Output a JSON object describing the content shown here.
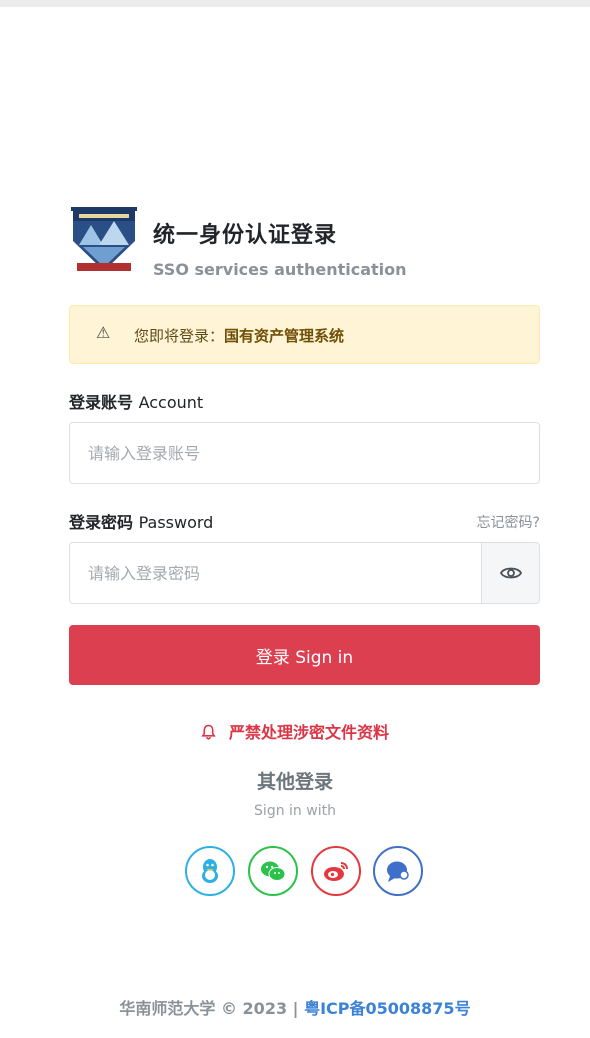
{
  "header": {
    "title": "统一身份认证登录",
    "subtitle": "SSO services authentication"
  },
  "alert": {
    "prefix": "您即将登录：",
    "system_name": "国有资产管理系统",
    "icon": "warning-triangle-icon"
  },
  "account": {
    "label_cn": "登录账号",
    "label_en": "Account",
    "placeholder": "请输入登录账号"
  },
  "password": {
    "label_cn": "登录密码",
    "label_en": "Password",
    "placeholder": "请输入登录密码",
    "forgot_link": "忘记密码?",
    "toggle_icon": "eye-icon"
  },
  "signin": {
    "label": "登录 Sign in",
    "color": "#dc3f50"
  },
  "notice": {
    "text": "严禁处理涉密文件资料",
    "icon": "bell-icon",
    "color": "#dc3545"
  },
  "other_login": {
    "title": "其他登录",
    "subtitle": "Sign in with",
    "providers": [
      {
        "name": "qq",
        "icon": "qq-penguin-icon",
        "color": "#2bb0e6"
      },
      {
        "name": "wechat",
        "icon": "wechat-icon",
        "color": "#2bc24a"
      },
      {
        "name": "weibo",
        "icon": "weibo-icon",
        "color": "#e6373e"
      },
      {
        "name": "message",
        "icon": "chat-bubble-icon",
        "color": "#3f6fc9"
      }
    ]
  },
  "footer": {
    "text": "华南师范大学 © 2023 | ",
    "icp": "粤ICP备05008875号"
  }
}
